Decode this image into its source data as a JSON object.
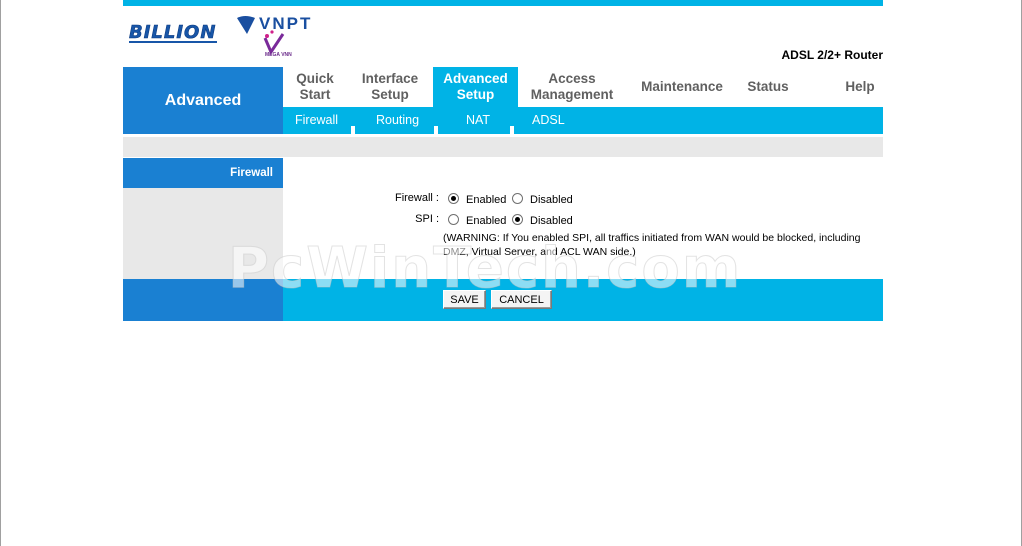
{
  "header": {
    "brand_logo_text": "BILLION",
    "partner_logo_text": "VNPT",
    "partner_logo_subtext": "MEGA VNN",
    "product_name": "ADSL 2/2+ Router"
  },
  "nav": {
    "section_title": "Advanced",
    "menu": [
      {
        "line1": "Quick",
        "line2": "Start"
      },
      {
        "line1": "Interface",
        "line2": "Setup"
      },
      {
        "line1": "Advanced",
        "line2": "Setup"
      },
      {
        "line1": "Access",
        "line2": "Management"
      },
      {
        "line1": "Maintenance",
        "line2": ""
      },
      {
        "line1": "Status",
        "line2": ""
      },
      {
        "line1": "Help",
        "line2": ""
      }
    ],
    "active_menu": "Advanced Setup",
    "submenu": [
      "Firewall",
      "Routing",
      "NAT",
      "ADSL"
    ]
  },
  "sidebar": {
    "heading": "Firewall"
  },
  "form": {
    "firewall": {
      "label": "Firewall :",
      "options": [
        "Enabled",
        "Disabled"
      ],
      "selected": "Enabled"
    },
    "spi": {
      "label": "SPI :",
      "options": [
        "Enabled",
        "Disabled"
      ],
      "selected": "Disabled"
    },
    "warning": "(WARNING: If You enabled SPI, all traffics initiated from WAN would be blocked, including DMZ, Virtual Server, and ACL WAN side.)",
    "save_label": "SAVE",
    "cancel_label": "CANCEL"
  },
  "watermark": "PcWinTech.com",
  "colors": {
    "accent_dark_blue": "#1a80d2",
    "accent_cyan": "#00b3e6",
    "panel_gray": "#e8e8e8"
  }
}
